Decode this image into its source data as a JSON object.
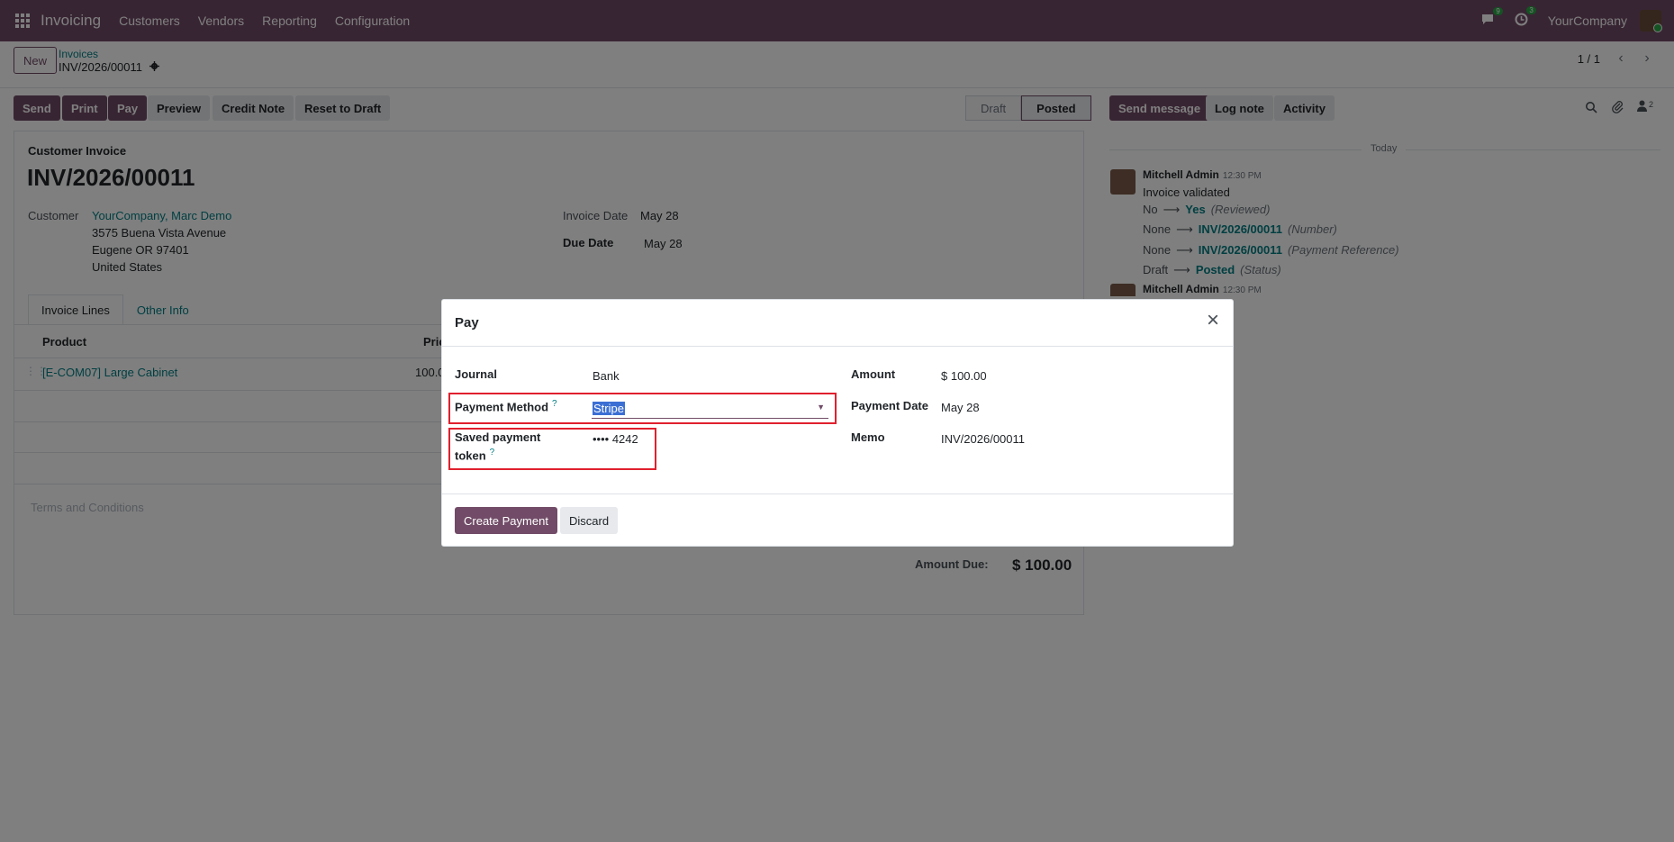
{
  "navbar": {
    "brand": "Invoicing",
    "menu": [
      "Customers",
      "Vendors",
      "Reporting",
      "Configuration"
    ],
    "messages_count": "9",
    "activities_count": "3",
    "company": "YourCompany"
  },
  "control": {
    "new_label": "New",
    "breadcrumb_parent": "Invoices",
    "breadcrumb_current": "INV/2026/00011",
    "pager": "1 / 1"
  },
  "actions": {
    "send": "Send",
    "print": "Print",
    "pay": "Pay",
    "preview": "Preview",
    "credit_note": "Credit Note",
    "reset_to_draft": "Reset to Draft",
    "status_draft": "Draft",
    "status_posted": "Posted"
  },
  "chatter_buttons": {
    "send_message": "Send message",
    "log_note": "Log note",
    "activity": "Activity",
    "followers_count": "2"
  },
  "form": {
    "type_label": "Customer Invoice",
    "number": "INV/2026/00011",
    "customer_label": "Customer",
    "customer_name": "YourCompany, Marc Demo",
    "address_line1": "3575 Buena Vista Avenue",
    "address_line2": "Eugene OR 97401",
    "address_line3": "United States",
    "invoice_date_label": "Invoice Date",
    "invoice_date": "May 28",
    "due_date_label": "Due Date",
    "due_date": "May 28",
    "tabs": [
      "Invoice Lines",
      "Other Info"
    ],
    "col_product": "Product",
    "col_price": "Pric",
    "line_product": "[E-COM07] Large Cabinet",
    "line_price": "100.0",
    "terms_placeholder": "Terms and Conditions",
    "amount_due_label": "Amount Due:",
    "amount_due": "$ 100.00"
  },
  "chatter": {
    "today": "Today",
    "author": "Mitchell Admin",
    "time": "12:30 PM",
    "body": "Invoice validated",
    "tracking": [
      {
        "old": "No",
        "new": "Yes",
        "field": "(Reviewed)"
      },
      {
        "old": "None",
        "new": "INV/2026/00011",
        "field": "(Number)"
      },
      {
        "old": "None",
        "new": "INV/2026/00011",
        "field": "(Payment Reference)"
      },
      {
        "old": "Draft",
        "new": "Posted",
        "field": "(Status)"
      }
    ],
    "author2": "Mitchell Admin",
    "time2": "12:30 PM"
  },
  "dialog": {
    "title": "Pay",
    "journal_label": "Journal",
    "journal_value": "Bank",
    "payment_method_label": "Payment Method",
    "payment_method_value": "Stripe",
    "token_label_1": "Saved payment",
    "token_label_2": "token",
    "token_value": "•••• 4242",
    "help_mark": "?",
    "amount_label": "Amount",
    "amount_value": "$ 100.00",
    "payment_date_label": "Payment Date",
    "payment_date_value": "May 28",
    "memo_label": "Memo",
    "memo_value": "INV/2026/00011",
    "create_payment": "Create Payment",
    "discard": "Discard"
  },
  "colors": {
    "brand": "#714b67",
    "link": "#017e84",
    "highlight_box": "#e0202e"
  }
}
